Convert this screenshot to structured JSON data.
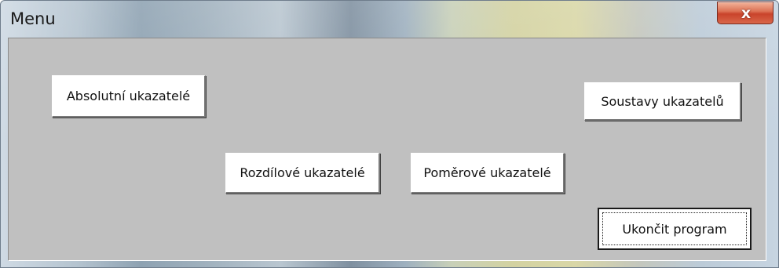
{
  "window": {
    "title": "Menu"
  },
  "titlebar": {
    "close_icon": "close-icon",
    "close_glyph": "x"
  },
  "buttons": {
    "absolutni": "Absolutní ukazatelé",
    "soustavy": "Soustavy ukazatelů",
    "rozdilove": "Rozdílové ukazatelé",
    "pomerove": "Poměrové ukazatelé",
    "ukoncit": "Ukončit program"
  },
  "colors": {
    "client_background": "#c0c0c0",
    "button_background": "#ffffff",
    "close_button": "#c9432b"
  }
}
